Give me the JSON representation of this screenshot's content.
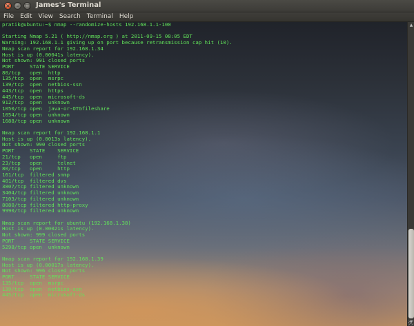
{
  "window": {
    "title": "James's Terminal"
  },
  "controls": {
    "close_glyph": "×",
    "minimize_glyph": "–",
    "maximize_glyph": "□"
  },
  "menu": [
    "File",
    "Edit",
    "View",
    "Search",
    "Terminal",
    "Help"
  ],
  "terminal": {
    "lines": [
      "pratik@ubuntu:~$ nmap --randomize-hosts 192.168.1.1-100",
      "",
      "Starting Nmap 5.21 ( http://nmap.org ) at 2011-09-15 08:05 EDT",
      "Warning: 192.168.1.1 giving up on port because retransmission cap hit (10).",
      "Nmap scan report for 192.168.1.34",
      "Host is up (0.00041s latency).",
      "Not shown: 991 closed ports",
      "PORT     STATE SERVICE",
      "80/tcp   open  http",
      "135/tcp  open  msrpc",
      "139/tcp  open  netbios-ssn",
      "443/tcp  open  https",
      "445/tcp  open  microsoft-ds",
      "912/tcp  open  unknown",
      "1050/tcp open  java-or-OTGfileshare",
      "1054/tcp open  unknown",
      "1688/tcp open  unknown",
      "",
      "Nmap scan report for 192.168.1.1",
      "Host is up (0.0013s latency).",
      "Not shown: 990 closed ports",
      "PORT     STATE    SERVICE",
      "21/tcp   open     ftp",
      "23/tcp   open     telnet",
      "80/tcp   open     http",
      "161/tcp  filtered snmp",
      "401/tcp  filtered dvs",
      "3807/tcp filtered unknown",
      "3404/tcp filtered unknown",
      "7103/tcp filtered unknown",
      "8080/tcp filtered http-proxy",
      "9990/tcp filtered unknown",
      "",
      "Nmap scan report for ubuntu (192.168.1.38)",
      "Host is up (0.00021s latency).",
      "Not shown: 999 closed ports",
      "PORT     STATE SERVICE",
      "5298/tcp open  unknown",
      "",
      "Nmap scan report for 192.168.1.39",
      "Host is up (0.00017s latency).",
      "Not shown: 996 closed ports",
      "PORT     STATE SERVICE",
      "135/tcp  open  msrpc",
      "139/tcp  open  netbios-ssn",
      "445/tcp  open  microsoft-ds"
    ]
  },
  "scrollbar": {
    "up_glyph": "▲",
    "down_glyph": "▼"
  }
}
